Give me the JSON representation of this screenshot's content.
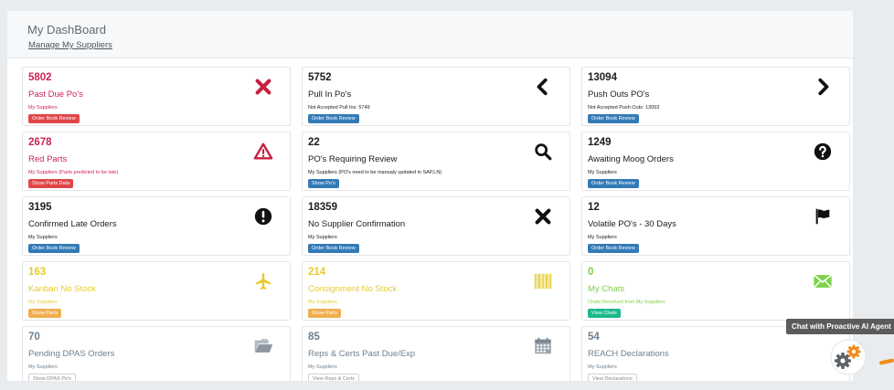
{
  "header": {
    "title": "My DashBoard",
    "manage_link": "Manage My Suppliers"
  },
  "cards": [
    {
      "count": "5802",
      "title": "Past Due Po's",
      "subtitle": "My Suppliers",
      "button": "Order Book Review",
      "icon": "close-icon"
    },
    {
      "count": "5752",
      "title": "Pull In Po's",
      "subtitle": "Not Accepted Pull Ins: 5749",
      "button": "Order Book Review",
      "icon": "chevron-left-icon"
    },
    {
      "count": "13094",
      "title": "Push Outs PO's",
      "subtitle": "Not Accepted Push Outs: 13093",
      "button": "Order Book Review",
      "icon": "chevron-right-icon"
    },
    {
      "count": "2678",
      "title": "Red Parts",
      "subtitle": "My Suppliers (Parts predicted to be late)",
      "button": "Show Parts Data",
      "icon": "warning-icon"
    },
    {
      "count": "22",
      "title": "PO's Requiring Review",
      "subtitle": "My Suppliers (PO's need to be manualy updated in SAP,LN)",
      "button": "Show Po's",
      "icon": "search-icon"
    },
    {
      "count": "1249",
      "title": "Awaiting Moog Orders",
      "subtitle": "My Suppliers",
      "button": "Order Book Review",
      "icon": "question-icon"
    },
    {
      "count": "3195",
      "title": "Confirmed Late Orders",
      "subtitle": "My Suppliers",
      "button": "Order Book Review",
      "icon": "exclamation-icon"
    },
    {
      "count": "18359",
      "title": "No Supplier Confirmation",
      "subtitle": "My Suppliers",
      "button": "Order Book Review",
      "icon": "close-icon"
    },
    {
      "count": "12",
      "title": "Volatile PO's - 30 Days",
      "subtitle": "My Suppliers",
      "button": "Order Book Review",
      "icon": "flag-icon"
    },
    {
      "count": "163",
      "title": "Kanban No Stock",
      "subtitle": "My Suppliers",
      "button": "Show Parts",
      "icon": "plane-icon"
    },
    {
      "count": "214",
      "title": "Consignment No Stock",
      "subtitle": "My Suppliers",
      "button": "Show Parts",
      "icon": "barcode-icon"
    },
    {
      "count": "0",
      "title": "My Chats",
      "subtitle": "Chats Received from My Suppliers",
      "button": "View Chats",
      "icon": "envelope-icon"
    },
    {
      "count": "70",
      "title": "Pending DPAS Orders",
      "subtitle": "My Suppliers",
      "button": "Show DPAS Po's",
      "icon": "folder-icon"
    },
    {
      "count": "85",
      "title": "Reps & Certs Past Due/Exp",
      "subtitle": "My Suppliers",
      "button": "View Reps & Certs",
      "icon": "calendar-icon"
    },
    {
      "count": "54",
      "title": "REACH Declarations",
      "subtitle": "My Suppliers",
      "button": "View Declarations",
      "icon": "reach-icon"
    }
  ],
  "chat_widget": {
    "tooltip": "Chat with Proactive AI Agent",
    "icon": "gears-icon"
  },
  "colors": {
    "red_text": "#cc2456",
    "yellow_text": "#e5cc2c",
    "green_text": "#7fcf4a",
    "gray_text": "#6f7f8d",
    "blue_button": "#337ab7",
    "red_button": "#e0464a",
    "orange_button": "#f0ad4e",
    "teal_button": "#1cb88d"
  }
}
